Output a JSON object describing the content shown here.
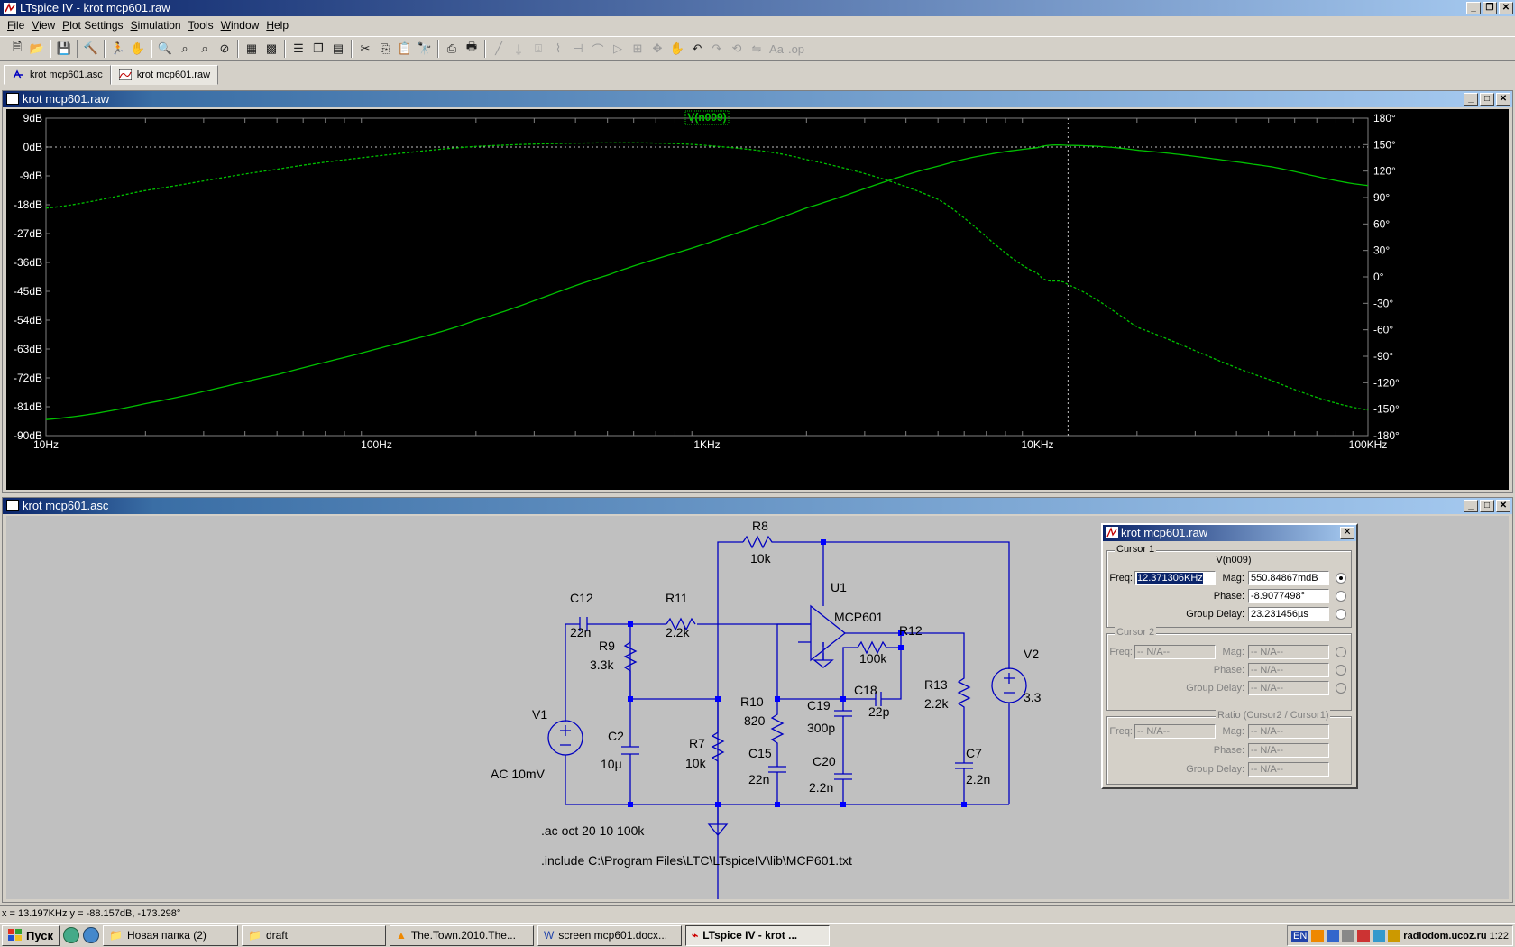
{
  "app": {
    "title": "LTspice IV - krot mcp601.raw"
  },
  "menu": [
    "File",
    "View",
    "Plot Settings",
    "Simulation",
    "Tools",
    "Window",
    "Help"
  ],
  "tabs": [
    {
      "label": "krot mcp601.asc"
    },
    {
      "label": "krot mcp601.raw"
    }
  ],
  "plot_window": {
    "title": "krot mcp601.raw",
    "trace_label": "V(n009)"
  },
  "schematic_window": {
    "title": "krot mcp601.asc",
    "directives": [
      ".ac oct 20 10 100k",
      ".include C:\\Program Files\\LTC\\LTspiceIV\\lib\\MCP601.txt"
    ],
    "components": [
      {
        "ref": "R8",
        "value": "10k"
      },
      {
        "ref": "C12",
        "value": "22n"
      },
      {
        "ref": "R11",
        "value": "2.2k"
      },
      {
        "ref": "U1",
        "value": "MCP601"
      },
      {
        "ref": "R12",
        "value": "100k"
      },
      {
        "ref": "R9",
        "value": "3.3k"
      },
      {
        "ref": "V1",
        "value": "AC 10mV"
      },
      {
        "ref": "C2",
        "value": "10μ"
      },
      {
        "ref": "R7",
        "value": "10k"
      },
      {
        "ref": "R10",
        "value": "820"
      },
      {
        "ref": "C19",
        "value": "300p"
      },
      {
        "ref": "C18",
        "value": "22p"
      },
      {
        "ref": "C15",
        "value": "22n"
      },
      {
        "ref": "C20",
        "value": "2.2n"
      },
      {
        "ref": "R13",
        "value": "2.2k"
      },
      {
        "ref": "C7",
        "value": "2.2n"
      },
      {
        "ref": "V2",
        "value": "3.3"
      }
    ]
  },
  "cursor_dialog": {
    "title": "krot mcp601.raw",
    "cursor1": {
      "group": "Cursor 1",
      "trace": "V(n009)",
      "freq_label": "Freq:",
      "freq": "12.371306KHz",
      "mag_label": "Mag:",
      "mag": "550.84867mdB",
      "phase_label": "Phase:",
      "phase": "-8.9077498°",
      "gd_label": "Group Delay:",
      "gd": "23.231456µs"
    },
    "cursor2": {
      "group": "Cursor 2",
      "freq_label": "Freq:",
      "freq": "-- N/A--",
      "mag_label": "Mag:",
      "mag": "-- N/A--",
      "phase_label": "Phase:",
      "phase": "-- N/A--",
      "gd_label": "Group Delay:",
      "gd": "-- N/A--"
    },
    "ratio": {
      "group": "Ratio (Cursor2 / Cursor1)",
      "freq_label": "Freq:",
      "freq": "-- N/A--",
      "mag_label": "Mag:",
      "mag": "-- N/A--",
      "phase_label": "Phase:",
      "phase": "-- N/A--",
      "gd_label": "Group Delay:",
      "gd": "-- N/A--"
    }
  },
  "status": {
    "text": "x = 13.197KHz     y = -88.157dB, -173.298°"
  },
  "taskbar": {
    "start": "Пуск",
    "tasks": [
      {
        "label": "Новая папка (2)",
        "active": false
      },
      {
        "label": "draft",
        "active": false
      },
      {
        "label": "The.Town.2010.The...",
        "active": false
      },
      {
        "label": "screen mcp601.docx...",
        "active": false
      },
      {
        "label": "LTspice IV - krot ...",
        "active": true
      }
    ],
    "tray_lang": "EN",
    "tray_watermark": "radiodom.ucoz.ru",
    "clock": "1:22"
  },
  "colors": {
    "trace": "#00c000",
    "bg_plot": "#000000",
    "schematic_wire": "#0000c0",
    "junction": "#0000ff"
  },
  "chart_data": {
    "type": "line",
    "xscale": "log",
    "x_ticks": [
      "10Hz",
      "100Hz",
      "1KHz",
      "10KHz",
      "100KHz"
    ],
    "xlim": [
      10,
      100000
    ],
    "y_left_ticks": [
      "9dB",
      "0dB",
      "-9dB",
      "-18dB",
      "-27dB",
      "-36dB",
      "-45dB",
      "-54dB",
      "-63dB",
      "-72dB",
      "-81dB",
      "-90dB"
    ],
    "ylim_left": [
      -90,
      9
    ],
    "y_right_ticks": [
      "180°",
      "150°",
      "120°",
      "90°",
      "60°",
      "30°",
      "0°",
      "-30°",
      "-60°",
      "-90°",
      "-120°",
      "-150°",
      "-180°"
    ],
    "ylim_right": [
      -180,
      180
    ],
    "cursor_x": 12371,
    "series": [
      {
        "name": "V(n009)",
        "style": "solid",
        "axis": "left",
        "x": [
          10,
          20,
          50,
          100,
          200,
          500,
          1000,
          2000,
          5000,
          10000,
          12371,
          20000,
          50000,
          100000
        ],
        "y": [
          -85,
          -80,
          -71,
          -63,
          -54,
          -40,
          -30,
          -19,
          -6,
          -0.2,
          0.55,
          -1,
          -6,
          -12
        ]
      },
      {
        "name": "phase",
        "style": "dashed",
        "axis": "right",
        "x": [
          10,
          20,
          50,
          100,
          200,
          500,
          1000,
          2000,
          5000,
          10000,
          12371,
          20000,
          50000,
          100000
        ],
        "y": [
          78,
          98,
          122,
          137,
          148,
          152,
          149,
          133,
          88,
          4,
          -8.9,
          -57,
          -116,
          -151
        ]
      }
    ]
  }
}
